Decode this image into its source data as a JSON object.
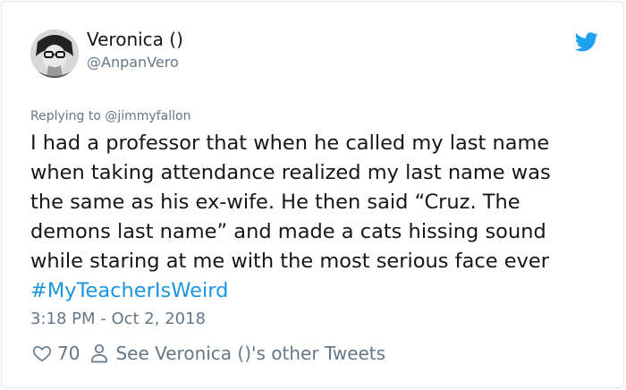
{
  "author": {
    "display_name": "Veronica ()",
    "handle": "@AnpanVero",
    "avatar_icon": "profile-photo"
  },
  "brand": {
    "icon": "twitter-bird-icon",
    "color": "#1da1f2"
  },
  "tweet": {
    "reply_to": "Replying to @jimmyfallon",
    "lines": [
      "I had a professor that when he called my last name",
      "when taking attendance realized my last name was",
      "the same as his ex-wife. He then said “Cruz. The",
      "demons last name” and made a cats hissing sound",
      "while staring at me with the most serious face ever"
    ],
    "hashtag": "#MyTeacherIsWeird",
    "timestamp": "3:18 PM - Oct 2, 2018"
  },
  "actions": {
    "like_icon": "heart-icon",
    "like_count": "70",
    "profile_icon": "person-icon",
    "other_tweets_label": "See Veronica ()'s other Tweets"
  },
  "colors": {
    "text": "#14171a",
    "muted": "#657786",
    "link": "#1b95e0",
    "border": "#e1e8ed"
  }
}
